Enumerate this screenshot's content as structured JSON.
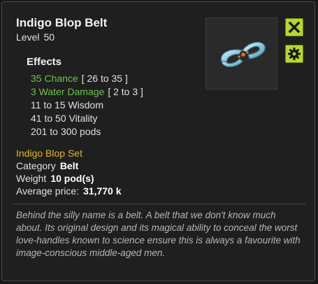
{
  "item": {
    "name": "Indigo Blop Belt",
    "level_label": "Level",
    "level_value": "50"
  },
  "effects": {
    "heading": "Effects",
    "lines": [
      {
        "text": "35 Chance",
        "range": "[ 26 to 35 ]",
        "color": "#6cc24a"
      },
      {
        "text": "3 Water Damage",
        "range": "[ 2 to 3 ]",
        "color": "#6cc24a"
      },
      {
        "text": "11 to 15 Wisdom"
      },
      {
        "text": "41 to 50 Vitality"
      },
      {
        "text": "201 to 300 pods"
      }
    ]
  },
  "details": {
    "set_name": "Indigo Blop Set",
    "category_label": "Category",
    "category_value": "Belt",
    "weight_label": "Weight",
    "weight_value": "10 pod(s)",
    "price_label": "Average price:",
    "price_value": "31,770 k"
  },
  "description": "Behind the silly name is a belt. A belt that we don't know much about. Its original design and its magical ability to conceal the worst love-handles known to science ensure this is always a favourite with image-conscious middle-aged men.",
  "icons": {
    "item": "blue-belt-item-icon",
    "close": "close-x-icon",
    "settings": "gear-icon"
  },
  "colors": {
    "accent_green": "#6cc24a",
    "set_gold": "#e0b62a",
    "button_lime": "#b7d82e"
  }
}
